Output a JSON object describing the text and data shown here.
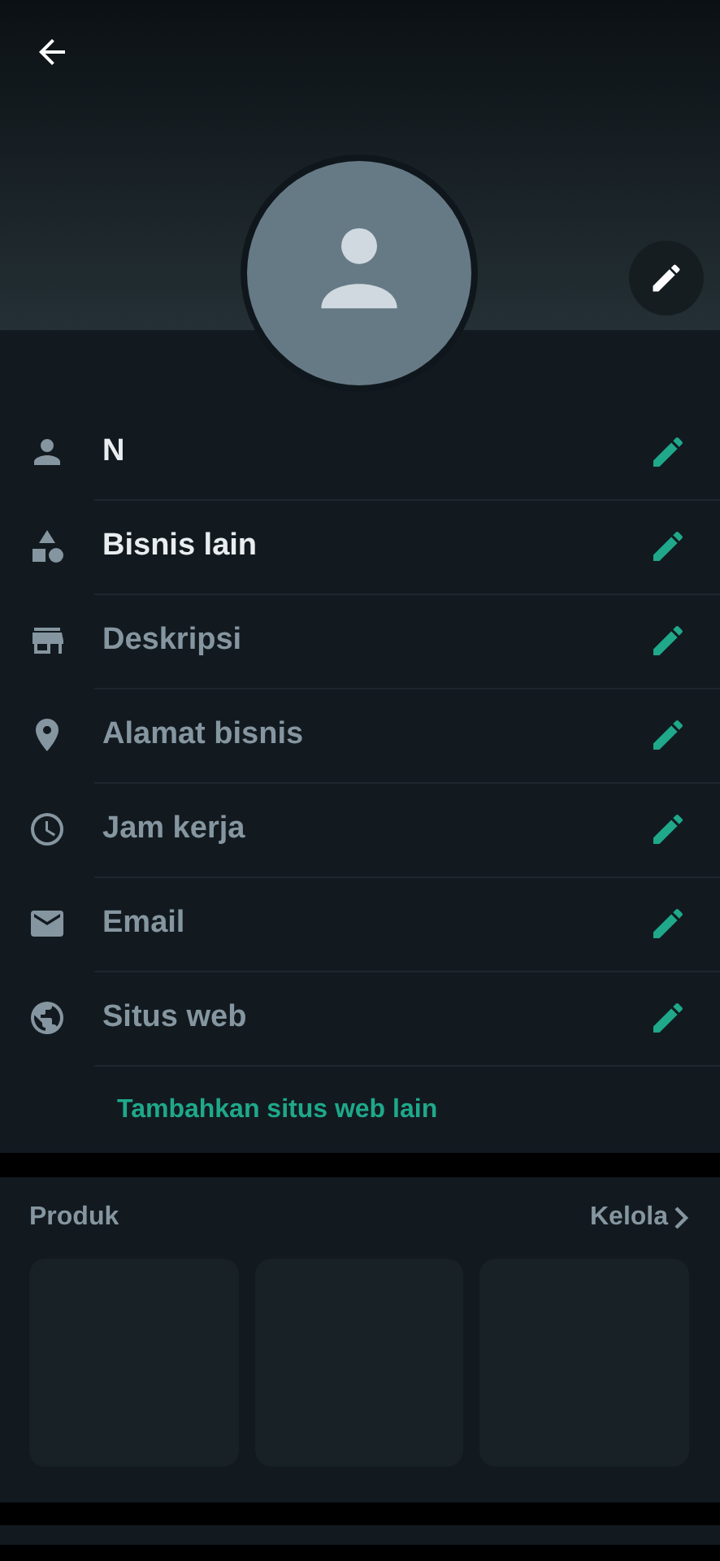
{
  "fields": [
    {
      "kind": "person",
      "value": "N"
    },
    {
      "kind": "category",
      "value": "Bisnis lain"
    },
    {
      "kind": "store",
      "placeholder": "Deskripsi"
    },
    {
      "kind": "location",
      "placeholder": "Alamat bisnis"
    },
    {
      "kind": "clock",
      "placeholder": "Jam kerja"
    },
    {
      "kind": "email",
      "placeholder": "Email"
    },
    {
      "kind": "website",
      "placeholder": "Situs web"
    }
  ],
  "add_website_link": "Tambahkan situs web lain",
  "products": {
    "title": "Produk",
    "manage_link": "Kelola",
    "items": [
      {
        "kind": "empty"
      },
      {
        "kind": "empty"
      },
      {
        "kind": "empty"
      }
    ]
  }
}
